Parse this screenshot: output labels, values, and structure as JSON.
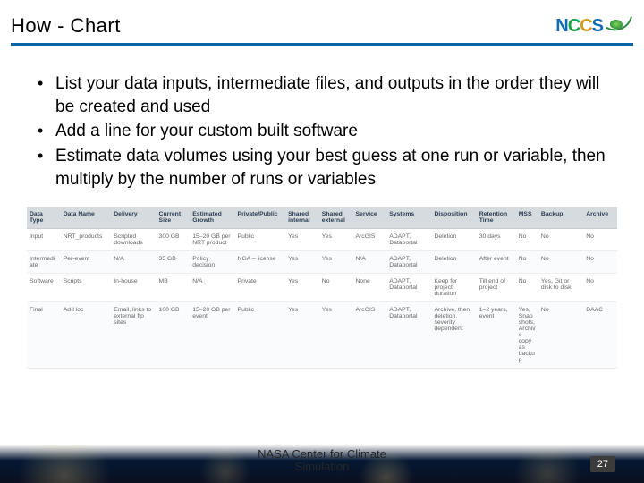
{
  "header": {
    "title": "How - Chart",
    "logo_text": {
      "n": "N",
      "c1": "C",
      "c2": "C",
      "s": "S"
    }
  },
  "bullets": [
    "List your data inputs, intermediate files, and outputs in the order they will be created and used",
    "Add a line for your custom built software",
    "Estimate data volumes using your best guess at one run or variable, then multiply by the number of runs or variables"
  ],
  "chart_data": {
    "type": "table",
    "columns": [
      "Data Type",
      "Data Name",
      "Delivery",
      "Current Size",
      "Estimated Growth",
      "Private/Public",
      "Shared internal",
      "Shared external",
      "Service",
      "Systems",
      "Disposition",
      "Retention Time",
      "MSS",
      "Backup",
      "Archive"
    ],
    "rows": [
      [
        "Input",
        "NRT_products",
        "Scripted downloads",
        "300 GB",
        "15–20 GB per NRT product",
        "Public",
        "Yes",
        "Yes",
        "ArcGIS",
        "ADAPT, Dataportal",
        "Deletion",
        "30 days",
        "No",
        "No",
        "No"
      ],
      [
        "Intermediate",
        "Per-event",
        "N/A",
        "35 GB",
        "Policy decision",
        "NGA – license",
        "Yes",
        "Yes",
        "N/A",
        "ADAPT, Dataportal",
        "Deletion",
        "After event",
        "No",
        "No",
        "No"
      ],
      [
        "Software",
        "Scripts",
        "In-house",
        "MB",
        "N/A",
        "Private",
        "Yes",
        "No",
        "None",
        "ADAPT, Dataportal",
        "Keep for project duration",
        "Till end of project",
        "No",
        "Yes, Git or disk to disk",
        "No"
      ],
      [
        "Final",
        "Ad-Hoc",
        "Email, links to external ftp sites",
        "100 GB",
        "15–20 GB per event",
        "Public",
        "Yes",
        "Yes",
        "ArcGIS",
        "ADAPT, Dataportal",
        "Archive, then deletion, severity dependent",
        "1–2 years, event",
        "Yes, Snapshots, Archive copy as backup",
        "No",
        "DAAC"
      ]
    ]
  },
  "footer": {
    "org": "NASA Center for Climate Simulation",
    "page": "27"
  }
}
